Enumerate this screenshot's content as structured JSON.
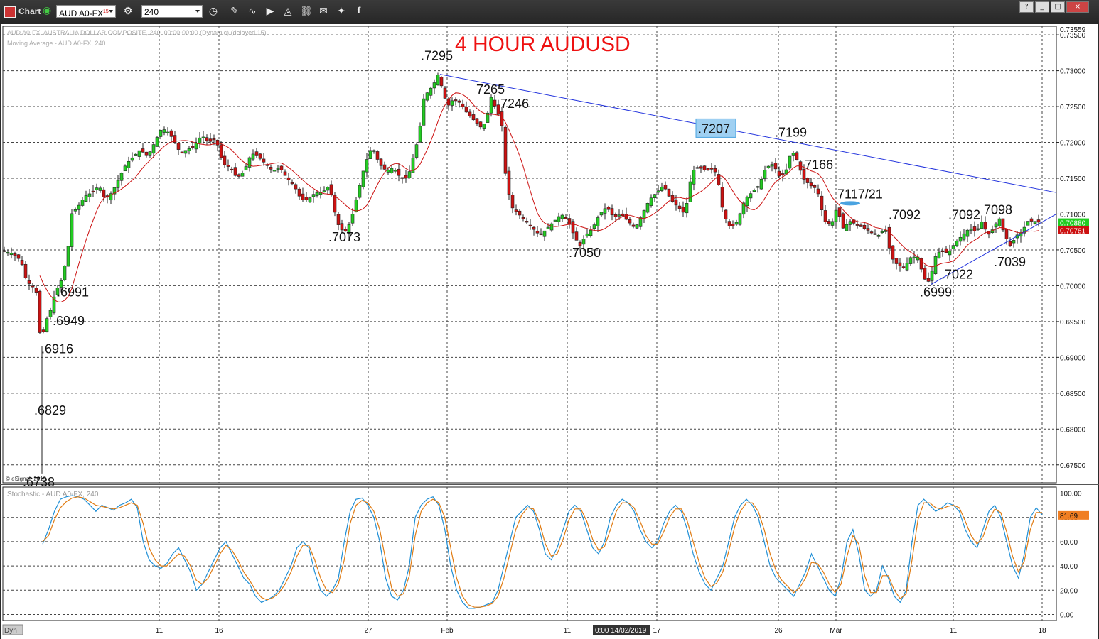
{
  "toolbar": {
    "title": "Chart",
    "symbol": "AUD A0-FX",
    "symbol_sup": "15",
    "interval": "240",
    "icons": [
      "gear-icon",
      "clock-icon",
      "pen-icon",
      "line-icon",
      "play-icon",
      "alert-icon",
      "link-icon",
      "chat-icon",
      "twitter-icon",
      "facebook-icon"
    ],
    "window_buttons": [
      "?",
      "_",
      "□",
      "×"
    ]
  },
  "chart_data": [
    {
      "type": "candlestick",
      "title": "4 HOUR AUDUSD",
      "title_color": "#ee1111",
      "legend": [
        "AUD A0-FX, AUSTRALIA DOLLAR COMPOSITE, 240, 00:00-00:00 (Dynamic) (delayed 15)",
        "Moving Average - AUD A0-FX, 240"
      ],
      "watermark": "© eSignal, 2019",
      "ylim": [
        0.6725,
        0.7362
      ],
      "y_ticks": [
        "0.67500",
        "0.68000",
        "0.68500",
        "0.69000",
        "0.69500",
        "0.70000",
        "0.70500",
        "0.71000",
        "0.71500",
        "0.72000",
        "0.72500",
        "0.73000",
        "0.73500"
      ],
      "y_top_label": "0.73559",
      "x_ticks": [
        "11",
        "16",
        "27",
        "Feb",
        "11",
        "17",
        "26",
        "Mar",
        "11",
        "18"
      ],
      "crosshair_date": "0:00 14/02/2019",
      "last_price_label": "0.70880",
      "ma_label": "0.70781",
      "price_path": [
        [
          0,
          0.705
        ],
        [
          20,
          0.7045
        ],
        [
          32,
          0.7035
        ],
        [
          40,
          0.7005
        ],
        [
          48,
          0.7
        ],
        [
          54,
          0.699
        ],
        [
          60,
          0.6916
        ],
        [
          66,
          0.695
        ],
        [
          72,
          0.696
        ],
        [
          80,
          0.699
        ],
        [
          90,
          0.701
        ],
        [
          98,
          0.705
        ],
        [
          103,
          0.71
        ],
        [
          112,
          0.711
        ],
        [
          122,
          0.7125
        ],
        [
          132,
          0.713
        ],
        [
          142,
          0.714
        ],
        [
          150,
          0.712
        ],
        [
          160,
          0.713
        ],
        [
          170,
          0.715
        ],
        [
          180,
          0.717
        ],
        [
          190,
          0.718
        ],
        [
          200,
          0.719
        ],
        [
          210,
          0.718
        ],
        [
          220,
          0.72
        ],
        [
          230,
          0.722
        ],
        [
          238,
          0.7215
        ],
        [
          246,
          0.7205
        ],
        [
          256,
          0.7185
        ],
        [
          266,
          0.719
        ],
        [
          276,
          0.7195
        ],
        [
          286,
          0.721
        ],
        [
          296,
          0.72
        ],
        [
          306,
          0.7205
        ],
        [
          316,
          0.717
        ],
        [
          326,
          0.7165
        ],
        [
          336,
          0.715
        ],
        [
          346,
          0.716
        ],
        [
          356,
          0.7185
        ],
        [
          366,
          0.718
        ],
        [
          376,
          0.717
        ],
        [
          386,
          0.716
        ],
        [
          396,
          0.7165
        ],
        [
          406,
          0.715
        ],
        [
          416,
          0.714
        ],
        [
          426,
          0.712
        ],
        [
          436,
          0.712
        ],
        [
          446,
          0.713
        ],
        [
          456,
          0.713
        ],
        [
          466,
          0.714
        ],
        [
          474,
          0.71
        ],
        [
          480,
          0.708
        ],
        [
          488,
          0.7075
        ],
        [
          496,
          0.709
        ],
        [
          506,
          0.713
        ],
        [
          516,
          0.717
        ],
        [
          526,
          0.7195
        ],
        [
          536,
          0.717
        ],
        [
          546,
          0.716
        ],
        [
          556,
          0.7165
        ],
        [
          566,
          0.715
        ],
        [
          576,
          0.715
        ],
        [
          584,
          0.718
        ],
        [
          592,
          0.721
        ],
        [
          598,
          0.726
        ],
        [
          604,
          0.727
        ],
        [
          612,
          0.728
        ],
        [
          619,
          0.7295
        ],
        [
          626,
          0.727
        ],
        [
          632,
          0.725
        ],
        [
          640,
          0.726
        ],
        [
          650,
          0.7255
        ],
        [
          660,
          0.724
        ],
        [
          670,
          0.723
        ],
        [
          680,
          0.722
        ],
        [
          686,
          0.723
        ],
        [
          694,
          0.7265
        ],
        [
          700,
          0.7246
        ],
        [
          708,
          0.723
        ],
        [
          714,
          0.715
        ],
        [
          722,
          0.711
        ],
        [
          732,
          0.71
        ],
        [
          742,
          0.709
        ],
        [
          752,
          0.708
        ],
        [
          762,
          0.707
        ],
        [
          772,
          0.708
        ],
        [
          782,
          0.709
        ],
        [
          792,
          0.71
        ],
        [
          802,
          0.709
        ],
        [
          810,
          0.707
        ],
        [
          818,
          0.7055
        ],
        [
          826,
          0.707
        ],
        [
          836,
          0.708
        ],
        [
          846,
          0.71
        ],
        [
          856,
          0.711
        ],
        [
          866,
          0.7095
        ],
        [
          876,
          0.71
        ],
        [
          886,
          0.709
        ],
        [
          896,
          0.708
        ],
        [
          906,
          0.71
        ],
        [
          916,
          0.712
        ],
        [
          926,
          0.713
        ],
        [
          936,
          0.714
        ],
        [
          946,
          0.712
        ],
        [
          956,
          0.711
        ],
        [
          966,
          0.71
        ],
        [
          976,
          0.716
        ],
        [
          986,
          0.7165
        ],
        [
          996,
          0.716
        ],
        [
          1006,
          0.7165
        ],
        [
          1012,
          0.715
        ],
        [
          1020,
          0.71
        ],
        [
          1030,
          0.708
        ],
        [
          1040,
          0.709
        ],
        [
          1050,
          0.712
        ],
        [
          1060,
          0.713
        ],
        [
          1070,
          0.714
        ],
        [
          1080,
          0.7165
        ],
        [
          1090,
          0.717
        ],
        [
          1100,
          0.715
        ],
        [
          1108,
          0.716
        ],
        [
          1116,
          0.719
        ],
        [
          1124,
          0.7175
        ],
        [
          1132,
          0.715
        ],
        [
          1142,
          0.714
        ],
        [
          1152,
          0.7135
        ],
        [
          1162,
          0.709
        ],
        [
          1172,
          0.7085
        ],
        [
          1180,
          0.711
        ],
        [
          1188,
          0.708
        ],
        [
          1198,
          0.709
        ],
        [
          1208,
          0.7085
        ],
        [
          1218,
          0.708
        ],
        [
          1228,
          0.7075
        ],
        [
          1238,
          0.707
        ],
        [
          1248,
          0.708
        ],
        [
          1256,
          0.704
        ],
        [
          1264,
          0.703
        ],
        [
          1274,
          0.7025
        ],
        [
          1284,
          0.704
        ],
        [
          1294,
          0.704
        ],
        [
          1302,
          0.701
        ],
        [
          1310,
          0.7005
        ],
        [
          1318,
          0.704
        ],
        [
          1326,
          0.705
        ],
        [
          1336,
          0.7045
        ],
        [
          1346,
          0.706
        ],
        [
          1356,
          0.707
        ],
        [
          1366,
          0.708
        ],
        [
          1376,
          0.7075
        ],
        [
          1384,
          0.709
        ],
        [
          1392,
          0.707
        ],
        [
          1400,
          0.708
        ],
        [
          1408,
          0.7095
        ],
        [
          1416,
          0.707
        ],
        [
          1424,
          0.7055
        ],
        [
          1432,
          0.707
        ],
        [
          1440,
          0.7075
        ],
        [
          1448,
          0.709
        ],
        [
          1458,
          0.709
        ],
        [
          1466,
          0.7088
        ]
      ],
      "annotations": [
        {
          "text": ".6738",
          "price": 0.672,
          "col": 32
        },
        {
          "text": ".6829",
          "price": 0.682,
          "col": 48
        },
        {
          "text": ".6916",
          "price": 0.6906,
          "col": 58
        },
        {
          "text": ".6949",
          "price": 0.6945,
          "col": 74
        },
        {
          "text": ".6991",
          "price": 0.6985,
          "col": 80
        },
        {
          "text": ".7073",
          "price": 0.7062,
          "col": 462
        },
        {
          "text": ".7295",
          "price": 0.7315,
          "col": 592
        },
        {
          "text": "7265",
          "price": 0.7268,
          "col": 670
        },
        {
          "text": "7246",
          "price": 0.7248,
          "col": 704
        },
        {
          "text": ".7050",
          "price": 0.704,
          "col": 800
        },
        {
          "text": ".7207",
          "price": 0.7213,
          "col": 982,
          "highlight": true
        },
        {
          "text": ".7199",
          "price": 0.7208,
          "col": 1090
        },
        {
          "text": "7166",
          "price": 0.7163,
          "col": 1132
        },
        {
          "text": "7117/21",
          "price": 0.7122,
          "col": 1178
        },
        {
          "text": ".7092",
          "price": 0.7093,
          "col": 1250
        },
        {
          "text": ".7092",
          "price": 0.7093,
          "col": 1334
        },
        {
          "text": "7098",
          "price": 0.71,
          "col": 1384
        },
        {
          "text": ".7022",
          "price": 0.701,
          "col": 1324
        },
        {
          "text": ".7039",
          "price": 0.7027,
          "col": 1398
        },
        {
          "text": ".6999",
          "price": 0.6985,
          "col": 1294
        }
      ],
      "trendlines": [
        {
          "from": [
            619,
            0.7295
          ],
          "to": [
            1486,
            0.713
          ],
          "color": "#2233dd"
        },
        {
          "from": [
            1310,
            0.7002
          ],
          "to": [
            1486,
            0.71
          ],
          "color": "#2233dd"
        }
      ]
    },
    {
      "type": "line",
      "title": "Stochastic - AUD A0-FX, 240",
      "ylim": [
        -5,
        105
      ],
      "y_ticks": [
        "0.00",
        "20.00",
        "40.00",
        "60.00",
        "80.00",
        "100.00"
      ],
      "last_value_label": "81.69",
      "series": [
        {
          "color": "#1f8fd6",
          "values": [
            58,
            70,
            85,
            95,
            97,
            98,
            97,
            95,
            90,
            85,
            90,
            88,
            86,
            90,
            92,
            95,
            88,
            60,
            45,
            40,
            38,
            42,
            50,
            55,
            45,
            35,
            20,
            25,
            35,
            45,
            55,
            60,
            50,
            40,
            30,
            25,
            15,
            10,
            12,
            15,
            20,
            30,
            40,
            55,
            60,
            55,
            35,
            20,
            15,
            20,
            30,
            60,
            85,
            95,
            96,
            90,
            80,
            60,
            30,
            15,
            12,
            20,
            40,
            80,
            90,
            95,
            97,
            90,
            70,
            40,
            20,
            10,
            5,
            5,
            6,
            8,
            10,
            20,
            40,
            60,
            80,
            85,
            90,
            85,
            70,
            50,
            45,
            55,
            70,
            85,
            90,
            85,
            70,
            55,
            50,
            60,
            80,
            90,
            95,
            92,
            85,
            70,
            60,
            55,
            60,
            75,
            85,
            90,
            85,
            70,
            50,
            35,
            25,
            20,
            30,
            40,
            60,
            80,
            90,
            95,
            90,
            80,
            60,
            40,
            30,
            25,
            20,
            15,
            25,
            35,
            50,
            40,
            30,
            20,
            15,
            30,
            60,
            70,
            50,
            20,
            15,
            20,
            40,
            30,
            15,
            10,
            20,
            60,
            90,
            95,
            90,
            85,
            88,
            92,
            90,
            85,
            70,
            60,
            55,
            70,
            85,
            90,
            80,
            60,
            40,
            30,
            50,
            80,
            88,
            82
          ]
        },
        {
          "color": "#e07b12",
          "values": [
            60,
            65,
            78,
            88,
            93,
            96,
            97,
            96,
            93,
            90,
            89,
            88,
            87,
            88,
            90,
            92,
            90,
            75,
            55,
            45,
            40,
            40,
            45,
            50,
            48,
            40,
            28,
            25,
            30,
            40,
            50,
            57,
            53,
            45,
            35,
            28,
            20,
            14,
            12,
            14,
            18,
            25,
            35,
            48,
            57,
            57,
            45,
            30,
            20,
            18,
            25,
            45,
            75,
            90,
            94,
            92,
            85,
            70,
            45,
            22,
            15,
            17,
            32,
            65,
            85,
            92,
            95,
            92,
            80,
            55,
            30,
            15,
            8,
            6,
            6,
            7,
            9,
            15,
            30,
            50,
            70,
            82,
            88,
            87,
            76,
            58,
            48,
            50,
            62,
            78,
            87,
            87,
            77,
            62,
            53,
            56,
            70,
            85,
            92,
            92,
            88,
            77,
            65,
            58,
            58,
            68,
            80,
            87,
            87,
            77,
            60,
            43,
            30,
            23,
            26,
            35,
            52,
            72,
            85,
            92,
            92,
            85,
            70,
            50,
            36,
            28,
            23,
            18,
            22,
            30,
            43,
            42,
            35,
            25,
            18,
            25,
            48,
            65,
            58,
            32,
            18,
            18,
            32,
            32,
            20,
            13,
            17,
            45,
            78,
            92,
            92,
            88,
            87,
            89,
            90,
            88,
            77,
            65,
            58,
            64,
            78,
            87,
            84,
            68,
            48,
            35,
            44,
            70,
            84,
            84
          ]
        }
      ]
    }
  ]
}
